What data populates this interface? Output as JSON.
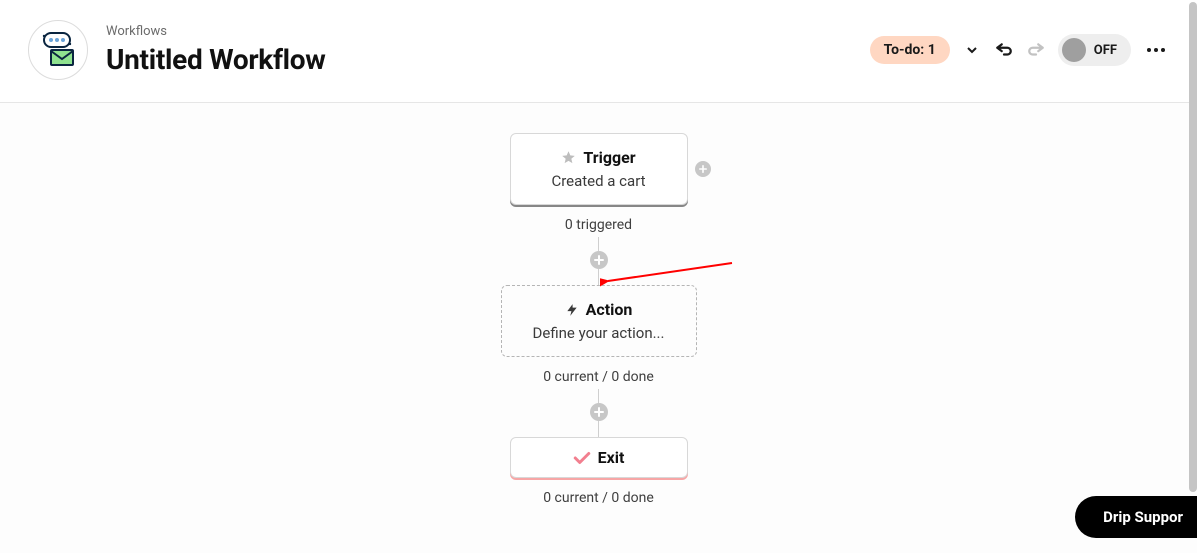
{
  "header": {
    "breadcrumb": "Workflows",
    "title": "Untitled Workflow",
    "todo_label": "To-do: 1",
    "toggle_label": "OFF"
  },
  "flow": {
    "trigger": {
      "heading": "Trigger",
      "desc": "Created a cart",
      "stat": "0 triggered"
    },
    "action": {
      "heading": "Action",
      "desc": "Define your action...",
      "stat": "0 current / 0 done"
    },
    "exit": {
      "heading": "Exit",
      "stat": "0 current / 0 done"
    }
  },
  "support": {
    "label": "Drip Suppor"
  },
  "colors": {
    "arrow": "#ff0000",
    "accent_pink": "#f27f8f"
  }
}
